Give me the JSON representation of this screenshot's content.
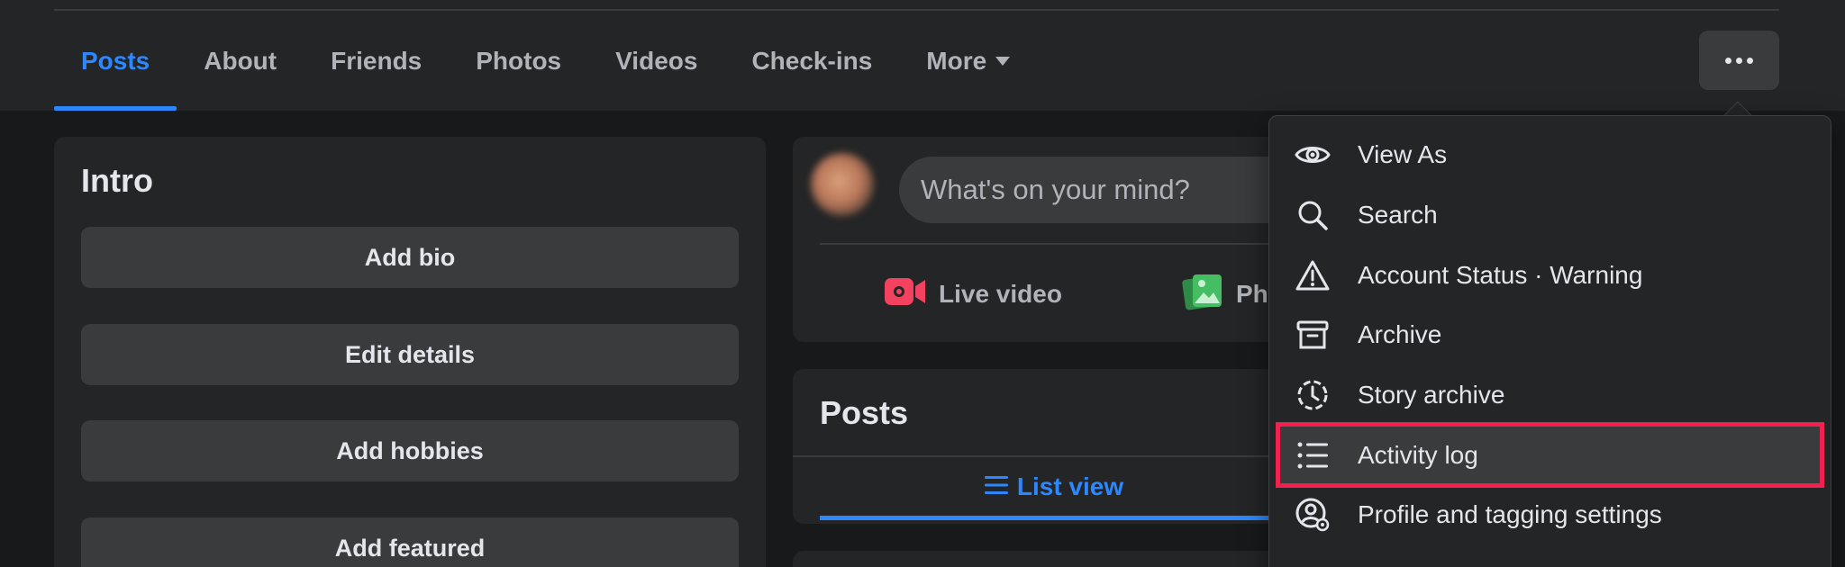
{
  "tabs": [
    {
      "label": "Posts",
      "active": true
    },
    {
      "label": "About"
    },
    {
      "label": "Friends"
    },
    {
      "label": "Photos"
    },
    {
      "label": "Videos"
    },
    {
      "label": "Check-ins"
    },
    {
      "label": "More",
      "dropdown": true
    }
  ],
  "intro": {
    "title": "Intro",
    "buttons": [
      "Add bio",
      "Edit details",
      "Add hobbies",
      "Add featured"
    ]
  },
  "composer": {
    "placeholder": "What's on your mind?",
    "live_video": "Live video",
    "photo_partial": "Ph"
  },
  "posts": {
    "title": "Posts",
    "list_view": "List view"
  },
  "menu": {
    "items": [
      {
        "label": "View As",
        "icon": "eye-icon"
      },
      {
        "label": "Search",
        "icon": "search-icon"
      },
      {
        "label": "Account Status · Warning",
        "icon": "warning-icon"
      },
      {
        "label": "Archive",
        "icon": "archive-icon"
      },
      {
        "label": "Story archive",
        "icon": "story-archive-icon"
      },
      {
        "label": "Activity log",
        "icon": "list-icon",
        "highlighted": true
      },
      {
        "label": "Profile and tagging settings",
        "icon": "profile-settings-icon"
      }
    ]
  },
  "colors": {
    "accent": "#2d88ff",
    "highlight_border": "#f0204f",
    "live_video": "#f3425f",
    "photo": "#45bd62"
  }
}
